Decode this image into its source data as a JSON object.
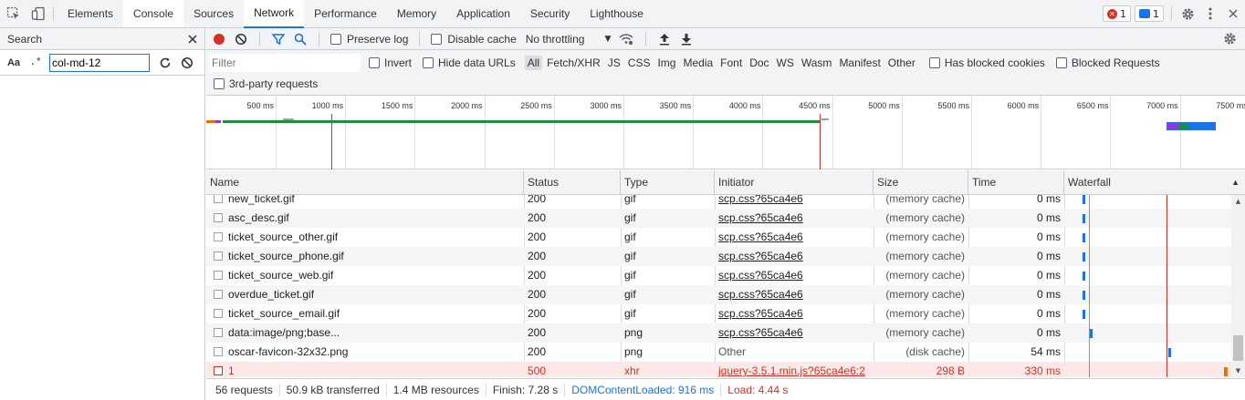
{
  "tabs": [
    "Elements",
    "Console",
    "Sources",
    "Network",
    "Performance",
    "Memory",
    "Application",
    "Security",
    "Lighthouse"
  ],
  "active_tab_index": 3,
  "console_tab_index": 1,
  "badges": {
    "errors": "1",
    "messages": "1"
  },
  "search_panel": {
    "title": "Search",
    "case_label": "Aa",
    "regex_label": ".*",
    "query": "col-md-12"
  },
  "toolbar": {
    "preserve_log": "Preserve log",
    "disable_cache": "Disable cache",
    "throttling": "No throttling"
  },
  "filter": {
    "placeholder": "Filter",
    "invert": "Invert",
    "hide_data_urls": "Hide data URLs",
    "types": [
      "All",
      "Fetch/XHR",
      "JS",
      "CSS",
      "Img",
      "Media",
      "Font",
      "Doc",
      "WS",
      "Wasm",
      "Manifest",
      "Other"
    ],
    "active_type_index": 0,
    "has_blocked_cookies": "Has blocked cookies",
    "blocked_requests": "Blocked Requests",
    "third_party": "3rd-party requests"
  },
  "overview_ticks": [
    "500 ms",
    "1000 ms",
    "1500 ms",
    "2000 ms",
    "2500 ms",
    "3000 ms",
    "3500 ms",
    "4000 ms",
    "4500 ms",
    "5000 ms",
    "5500 ms",
    "6000 ms",
    "6500 ms",
    "7000 ms",
    "7500 ms"
  ],
  "columns": [
    "Name",
    "Status",
    "Type",
    "Initiator",
    "Size",
    "Time",
    "Waterfall"
  ],
  "rows": [
    {
      "name": "new_ticket.gif",
      "status": "200",
      "type": "gif",
      "initiator": "scp.css?65ca4e6",
      "size": "(memory cache)",
      "time": "0 ms",
      "error": false,
      "initiator_link": true
    },
    {
      "name": "asc_desc.gif",
      "status": "200",
      "type": "gif",
      "initiator": "scp.css?65ca4e6",
      "size": "(memory cache)",
      "time": "0 ms",
      "error": false,
      "initiator_link": true
    },
    {
      "name": "ticket_source_other.gif",
      "status": "200",
      "type": "gif",
      "initiator": "scp.css?65ca4e6",
      "size": "(memory cache)",
      "time": "0 ms",
      "error": false,
      "initiator_link": true
    },
    {
      "name": "ticket_source_phone.gif",
      "status": "200",
      "type": "gif",
      "initiator": "scp.css?65ca4e6",
      "size": "(memory cache)",
      "time": "0 ms",
      "error": false,
      "initiator_link": true
    },
    {
      "name": "ticket_source_web.gif",
      "status": "200",
      "type": "gif",
      "initiator": "scp.css?65ca4e6",
      "size": "(memory cache)",
      "time": "0 ms",
      "error": false,
      "initiator_link": true
    },
    {
      "name": "overdue_ticket.gif",
      "status": "200",
      "type": "gif",
      "initiator": "scp.css?65ca4e6",
      "size": "(memory cache)",
      "time": "0 ms",
      "error": false,
      "initiator_link": true
    },
    {
      "name": "ticket_source_email.gif",
      "status": "200",
      "type": "gif",
      "initiator": "scp.css?65ca4e6",
      "size": "(memory cache)",
      "time": "0 ms",
      "error": false,
      "initiator_link": true
    },
    {
      "name": "data:image/png;base...",
      "status": "200",
      "type": "png",
      "initiator": "scp.css?65ca4e6",
      "size": "(memory cache)",
      "time": "0 ms",
      "error": false,
      "initiator_link": true
    },
    {
      "name": "oscar-favicon-32x32.png",
      "status": "200",
      "type": "png",
      "initiator": "Other",
      "size": "(disk cache)",
      "time": "54 ms",
      "error": false,
      "initiator_link": false
    },
    {
      "name": "1",
      "status": "500",
      "type": "xhr",
      "initiator": "jquery-3.5.1.min.js?65ca4e6:2",
      "size": "298 B",
      "time": "330 ms",
      "error": true,
      "initiator_link": true
    }
  ],
  "status_bar": {
    "requests": "56 requests",
    "transferred": "50.9 kB transferred",
    "resources": "1.4 MB resources",
    "finish": "Finish: 7.28 s",
    "dom_content_loaded": "DOMContentLoaded: 916 ms",
    "load": "Load: 4.44 s"
  },
  "colors": {
    "accent": "#1a73e8",
    "error_row_bg": "#fce8e6",
    "error_text": "#d93025",
    "dcl_line": "#1a73e8",
    "load_line": "#d93025",
    "record": "#d93025"
  }
}
